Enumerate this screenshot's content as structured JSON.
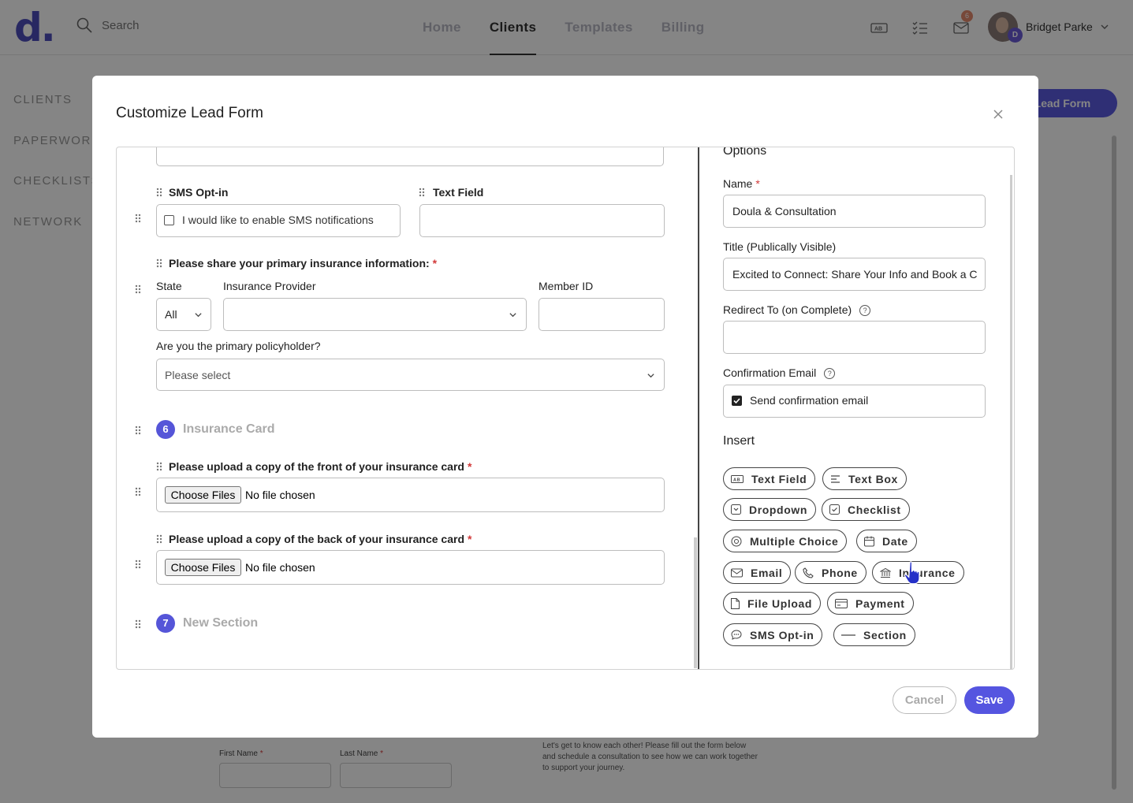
{
  "header": {
    "logo_text": "d",
    "logo_dot": ".",
    "search_placeholder": "Search",
    "nav": [
      "Home",
      "Clients",
      "Templates",
      "Billing"
    ],
    "active_nav": "Clients",
    "notification_count": "6",
    "avatar_initial": "D",
    "user_name": "Bridget Parke"
  },
  "sidebar": {
    "items": [
      "CLIENTS",
      "PAPERWORK",
      "CHECKLISTS",
      "NETWORK"
    ]
  },
  "page": {
    "new_lead_button": "v Lead Form",
    "first_name_label": "First Name",
    "last_name_label": "Last Name",
    "required_mark": "*",
    "description_lines": [
      "Let's get to know each other! Please fill out the form below",
      "and schedule a consultation to see how we can work together",
      "to support your journey."
    ]
  },
  "modal": {
    "title": "Customize Lead Form",
    "cancel_label": "Cancel",
    "save_label": "Save",
    "form": {
      "sms_optin_label": "SMS Opt-in",
      "sms_optin_checkbox_text": "I would like to enable SMS notifications",
      "text_field_label": "Text Field",
      "insurance_question": "Please share your primary insurance information:",
      "state_label": "State",
      "state_value": "All",
      "provider_label": "Insurance Provider",
      "member_id_label": "Member ID",
      "policyholder_question": "Are you the primary policyholder?",
      "policyholder_placeholder": "Please select",
      "section6_number": "6",
      "section6_title": "Insurance Card",
      "front_upload_label": "Please upload a copy of the front of your insurance card",
      "back_upload_label": "Please upload a copy of the back of your insurance card",
      "choose_files_label": "Choose Files",
      "no_file_text": "No file chosen",
      "section7_number": "7",
      "section7_title": "New Section",
      "required_mark": "*"
    },
    "options": {
      "heading": "Options",
      "name_label": "Name",
      "name_value": "Doula & Consultation",
      "title_label": "Title (Publically Visible)",
      "title_value": "Excited to Connect: Share Your Info and Book a C",
      "redirect_label": "Redirect To (on Complete)",
      "redirect_value": "",
      "confirmation_label": "Confirmation Email",
      "confirmation_checkbox_text": "Send confirmation email",
      "confirmation_checked": true,
      "help_glyph": "?",
      "required_mark": "*"
    },
    "insert": {
      "heading": "Insert",
      "chips": [
        {
          "label": "Text Field",
          "icon": "text-field-icon"
        },
        {
          "label": "Text Box",
          "icon": "text-box-icon"
        },
        {
          "label": "Dropdown",
          "icon": "dropdown-icon"
        },
        {
          "label": "Checklist",
          "icon": "checklist-icon"
        },
        {
          "label": "Multiple Choice",
          "icon": "radio-icon"
        },
        {
          "label": "Date",
          "icon": "calendar-icon"
        },
        {
          "label": "Email",
          "icon": "mail-icon"
        },
        {
          "label": "Phone",
          "icon": "phone-icon"
        },
        {
          "label": "Insurance",
          "icon": "bank-icon"
        },
        {
          "label": "File Upload",
          "icon": "file-icon"
        },
        {
          "label": "Payment",
          "icon": "card-icon"
        },
        {
          "label": "SMS Opt-in",
          "icon": "chat-icon"
        },
        {
          "label": "Section",
          "icon": "line-icon"
        }
      ]
    }
  },
  "colors": {
    "brand": "#5555e0",
    "required": "#d23a3a",
    "badge": "#e58a6d"
  }
}
